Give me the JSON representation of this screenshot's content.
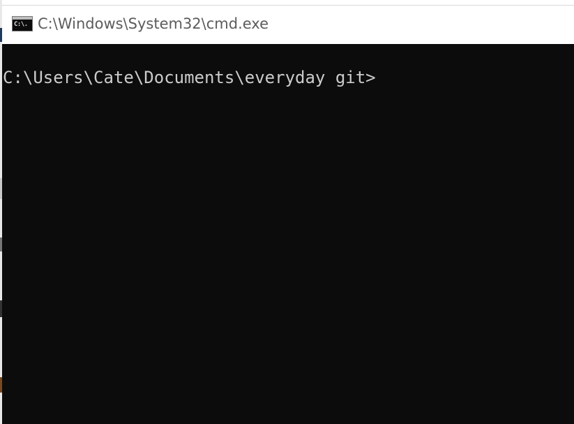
{
  "window": {
    "title": "C:\\Windows\\System32\\cmd.exe",
    "app_icon": "cmd-icon",
    "app_icon_text": "C:\\."
  },
  "console": {
    "prompt": "C:\\Users\\Cate\\Documents\\everyday git>",
    "background_color": "#0c0c0c",
    "text_color": "#cccccc"
  }
}
